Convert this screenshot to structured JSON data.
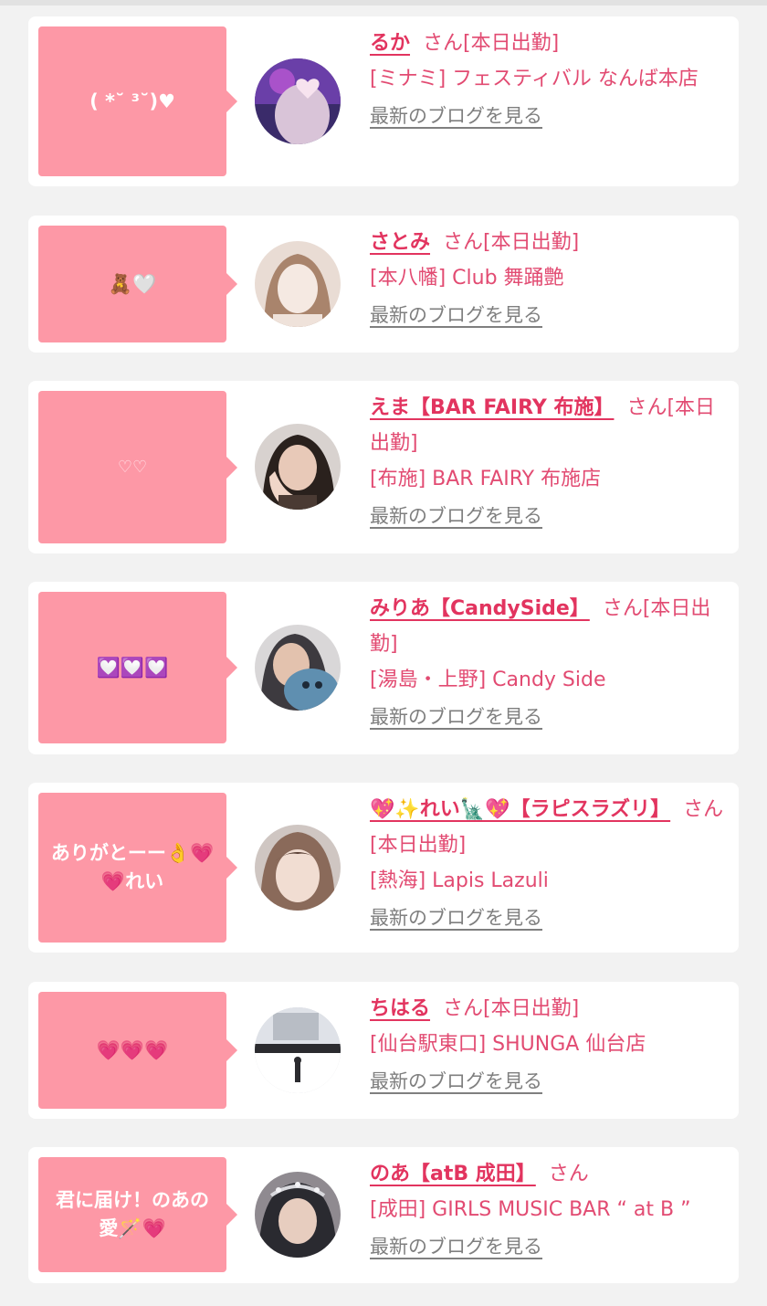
{
  "cards": [
    {
      "bubble": "( *˘ ³˘)♥",
      "name": "るか",
      "status": "さん[本日出勤]",
      "shop": "[ミナミ] フェスティバル なんば本店",
      "blog": "最新のブログを見る",
      "avatar_colors": [
        "#6a3fa8",
        "#c45bd9",
        "#3a2b6a"
      ]
    },
    {
      "bubble": "🧸🤍",
      "name": "さとみ",
      "status": "さん[本日出勤]",
      "shop": "[本八幡] Club 舞踊艶",
      "blog": "最新のブログを見る",
      "avatar_colors": [
        "#e9dcd4",
        "#a9846c",
        "#f5e9e2"
      ]
    },
    {
      "bubble": "♡♡",
      "name": "えま【BAR FAIRY 布施】",
      "status": "さん[本日出勤]",
      "shop": "[布施] BAR FAIRY 布施店",
      "blog": "最新のブログを見る",
      "avatar_colors": [
        "#4a3a33",
        "#e8c9b8",
        "#2a211d"
      ]
    },
    {
      "bubble": "💟💟💟",
      "name": "みりあ【CandySide】",
      "status": "さん[本日出勤]",
      "shop": "[湯島・上野] Candy Side",
      "blog": "最新のブログを見る",
      "avatar_colors": [
        "#3d3a3f",
        "#5f8fb0",
        "#e3c2ae"
      ]
    },
    {
      "bubble": "ありがとーー👌💗💗れい",
      "name": "💖✨れい🗽💖【ラピスラズリ】",
      "status": "さん[本日出勤]",
      "shop": "[熱海] Lapis Lazuli",
      "blog": "最新のブログを見る",
      "avatar_colors": [
        "#8a6a5a",
        "#f1ddd2",
        "#5a4035"
      ]
    },
    {
      "bubble": "💗💗💗",
      "name": "ちはる",
      "status": "さん[本日出勤]",
      "shop": "[仙台駅東口] SHUNGA 仙台店",
      "blog": "最新のブログを見る",
      "avatar_colors": [
        "#c9ccd2",
        "#ffffff",
        "#2b2b2f"
      ]
    },
    {
      "bubble": "君に届け！のあの愛🪄💗",
      "name": "のあ【atB 成田】",
      "status": "さん",
      "shop": "[成田] GIRLS MUSIC BAR “ at B ”",
      "blog": "最新のブログを見る",
      "avatar_colors": [
        "#2a2a30",
        "#e7cdbf",
        "#8f8a90"
      ]
    }
  ]
}
